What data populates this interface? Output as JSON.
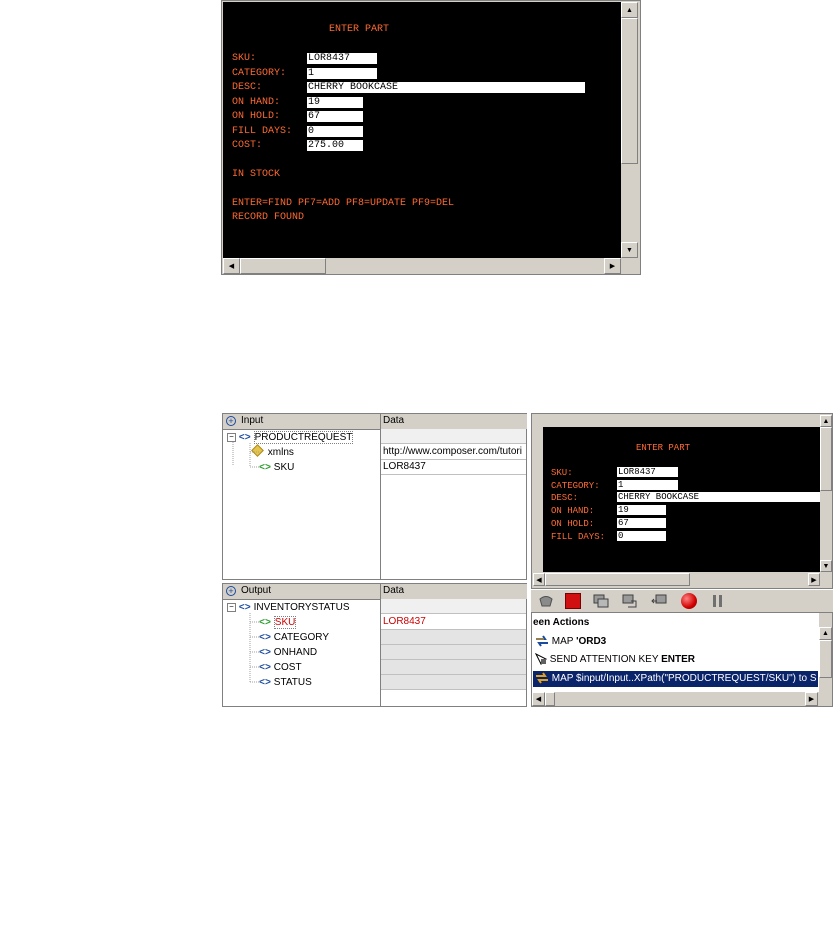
{
  "top_terminal": {
    "title": "ENTER PART",
    "fields": [
      {
        "label": "SKU:",
        "value": "LOR8437"
      },
      {
        "label": "CATEGORY:",
        "value": "1"
      },
      {
        "label": "DESC:",
        "value": "CHERRY BOOKCASE"
      },
      {
        "label": "ON HAND:",
        "value": "19"
      },
      {
        "label": "ON HOLD:",
        "value": "67"
      },
      {
        "label": "FILL DAYS:",
        "value": "0"
      },
      {
        "label": "COST:",
        "value": "275.00"
      }
    ],
    "stock_status": "IN STOCK",
    "keys_line": "ENTER=FIND PF7=ADD PF8=UPDATE PF9=DEL",
    "message": "RECORD FOUND"
  },
  "input_panel": {
    "header_label": "Input",
    "data_header": "Data",
    "root": "PRODUCTREQUEST",
    "children": [
      {
        "name": "xmlns",
        "value": "http://www.composer.com/tutori"
      },
      {
        "name": "SKU",
        "value": "LOR8437"
      }
    ]
  },
  "output_panel": {
    "header_label": "Output",
    "data_header": "Data",
    "root": "INVENTORYSTATUS",
    "children": [
      {
        "name": "SKU",
        "value": "LOR8437"
      },
      {
        "name": "CATEGORY",
        "value": ""
      },
      {
        "name": "ONHAND",
        "value": ""
      },
      {
        "name": "COST",
        "value": ""
      },
      {
        "name": "STATUS",
        "value": ""
      }
    ]
  },
  "preview_terminal": {
    "title": "ENTER PART",
    "fields": [
      {
        "label": "SKU:",
        "value": "LOR8437"
      },
      {
        "label": "CATEGORY:",
        "value": "1"
      },
      {
        "label": "DESC:",
        "value": "CHERRY BOOKCASE"
      },
      {
        "label": "ON HAND:",
        "value": "19"
      },
      {
        "label": "ON HOLD:",
        "value": "67"
      },
      {
        "label": "FILL DAYS:",
        "value": "0"
      }
    ]
  },
  "actions": {
    "header": "een Actions",
    "items": [
      {
        "icon": "map-arrows-icon",
        "prefix": "MAP ",
        "text": "'ORD3",
        "selected": false
      },
      {
        "icon": "attention-key-icon",
        "prefix": "SEND ATTENTION KEY ",
        "text": "ENTER",
        "selected": false
      },
      {
        "icon": "map-arrows-icon",
        "prefix": "",
        "text": "MAP $input/Input..XPath(\"PRODUCTREQUEST/SKU\") to S",
        "selected": true
      }
    ]
  },
  "colors": {
    "terminal_text": "#ff6a33",
    "output_value": "#cc0000",
    "selection": "#0a246a",
    "tag_blue": "#1c4a9c",
    "tag_green": "#2a9a2a"
  }
}
